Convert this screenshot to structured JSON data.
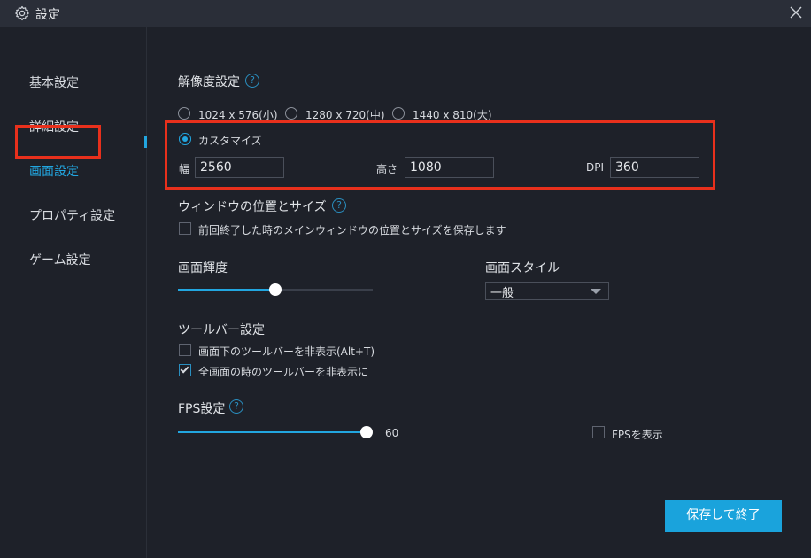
{
  "window": {
    "title": "設定"
  },
  "sidebar": {
    "items": [
      {
        "label": "基本設定"
      },
      {
        "label": "詳細設定"
      },
      {
        "label": "画面設定"
      },
      {
        "label": "プロパティ設定"
      },
      {
        "label": "ゲーム設定"
      }
    ],
    "active_index": 2
  },
  "resolution": {
    "heading": "解像度設定",
    "help": "?",
    "options": [
      "1024 x 576(小)",
      "1280 x 720(中)",
      "1440 x 810(大)"
    ],
    "custom_label": "カスタマイズ",
    "selected": "カスタマイズ",
    "width_label": "幅",
    "width_value": "2560",
    "height_label": "高さ",
    "height_value": "1080",
    "dpi_label": "DPI",
    "dpi_value": "360"
  },
  "window_position": {
    "heading": "ウィンドウの位置とサイズ",
    "help": "?",
    "save_label": "前回終了した時のメインウィンドウの位置とサイズを保存します",
    "save_checked": false
  },
  "brightness": {
    "heading": "画面輝度",
    "level_fraction": 0.5
  },
  "screen_style": {
    "heading": "画面スタイル",
    "selected": "一般"
  },
  "toolbar": {
    "heading": "ツールバー設定",
    "hide_bottom_label": "画面下のツールバーを非表示(Alt+T)",
    "hide_bottom_checked": false,
    "hide_fullscreen_label": "全画面の時のツールバーを非表示に",
    "hide_fullscreen_checked": true
  },
  "fps": {
    "heading": "FPS設定",
    "help": "?",
    "value": "60",
    "level_fraction": 1.0,
    "show_label": "FPSを表示",
    "show_checked": false
  },
  "footer": {
    "save_button": "保存して終了"
  },
  "colors": {
    "accent": "#22a6e0",
    "highlight_box": "#e8301c",
    "button": "#1aa3dc",
    "background": "#1e2129"
  },
  "icons": {
    "title": "gear-icon",
    "close": "close-icon"
  }
}
